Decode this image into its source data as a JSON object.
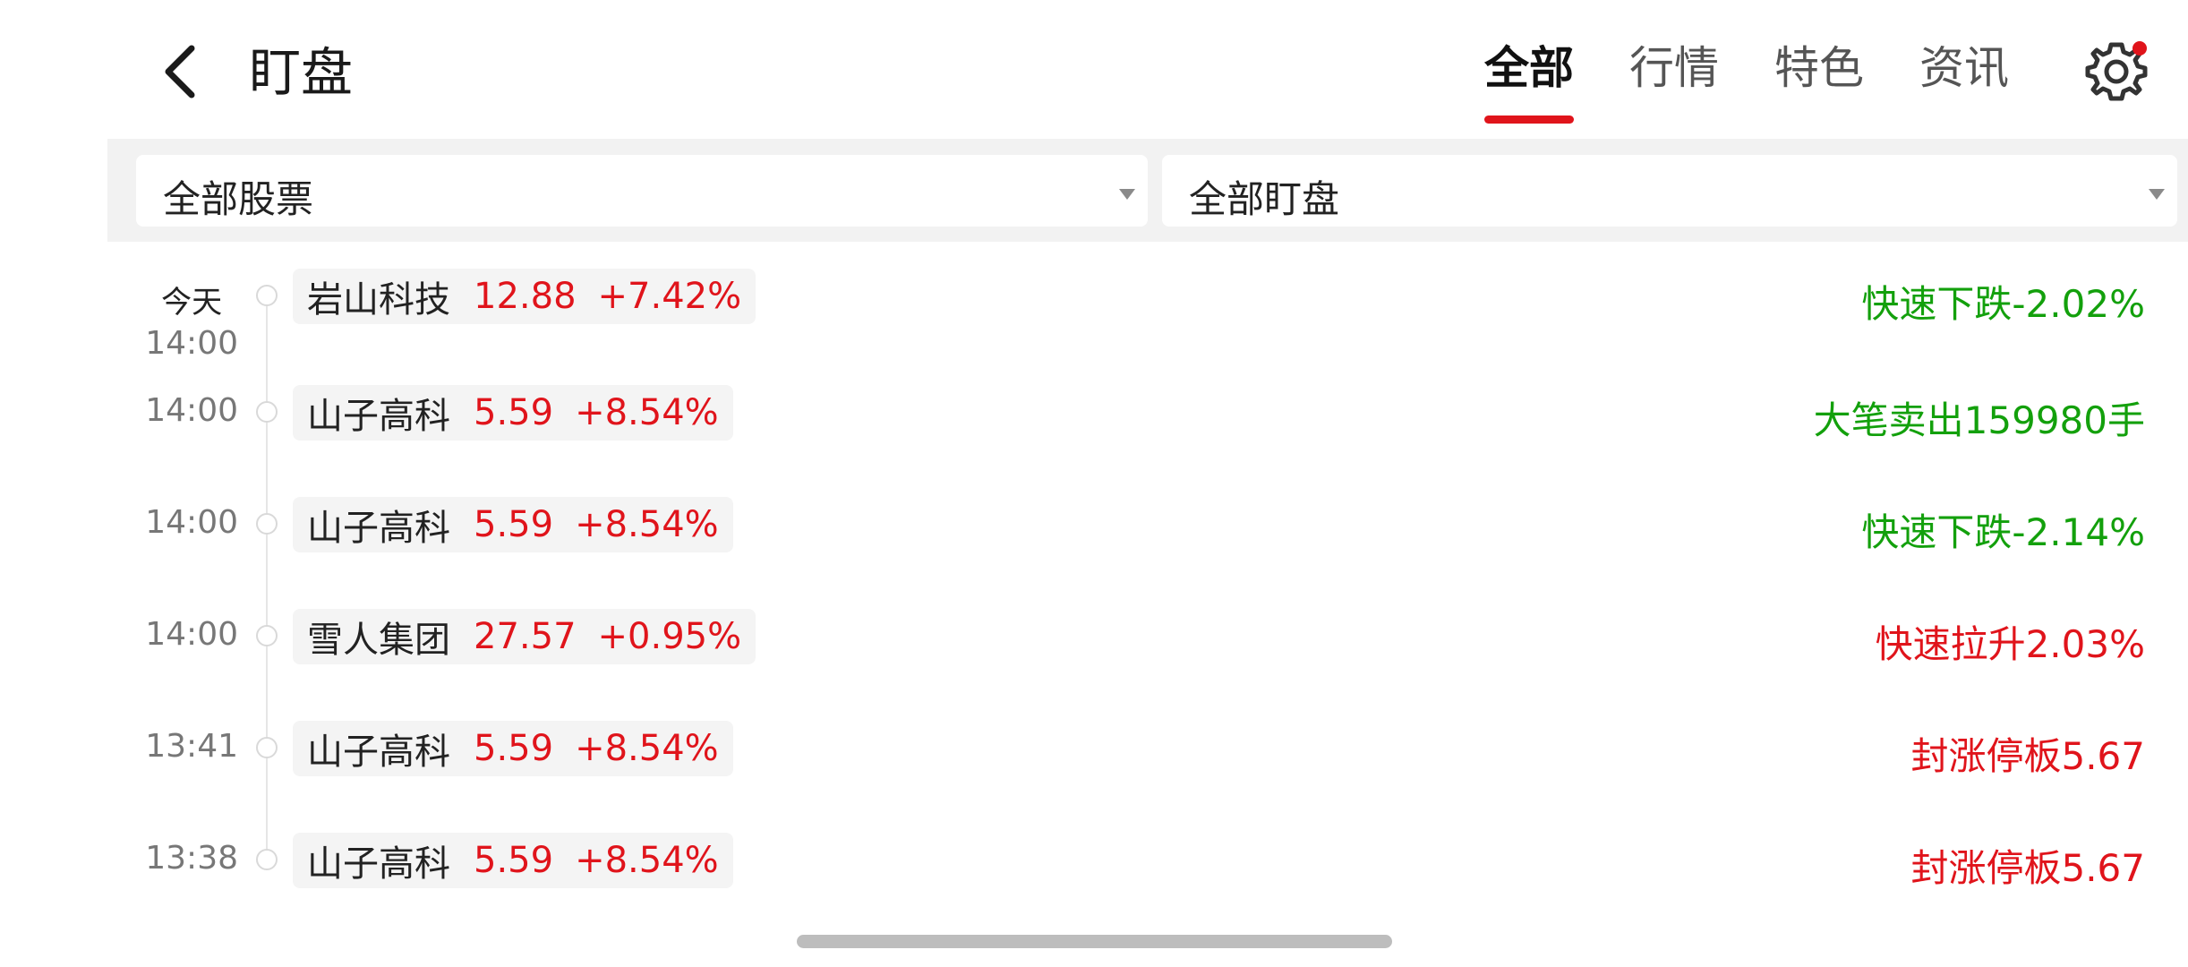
{
  "header": {
    "back_icon": "chevron-left-icon",
    "title": "盯盘",
    "tabs": [
      {
        "label": "全部",
        "active": true
      },
      {
        "label": "行情",
        "active": false
      },
      {
        "label": "特色",
        "active": false
      },
      {
        "label": "资讯",
        "active": false
      }
    ],
    "settings_icon": "gear-icon",
    "notification_dot": true
  },
  "filters": {
    "stocks": {
      "label": "全部股票"
    },
    "watch": {
      "label": "全部盯盘"
    }
  },
  "timeline": [
    {
      "day": "今天",
      "time": "14:00",
      "stock": "岩山科技",
      "price": "12.88",
      "change": "+7.42%",
      "event": "快速下跌-2.02%",
      "event_type": "down"
    },
    {
      "day": "",
      "time": "14:00",
      "stock": "山子高科",
      "price": "5.59",
      "change": "+8.54%",
      "event": "大笔卖出159980手",
      "event_type": "down"
    },
    {
      "day": "",
      "time": "14:00",
      "stock": "山子高科",
      "price": "5.59",
      "change": "+8.54%",
      "event": "快速下跌-2.14%",
      "event_type": "down"
    },
    {
      "day": "",
      "time": "14:00",
      "stock": "雪人集团",
      "price": "27.57",
      "change": "+0.95%",
      "event": "快速拉升2.03%",
      "event_type": "up"
    },
    {
      "day": "",
      "time": "13:41",
      "stock": "山子高科",
      "price": "5.59",
      "change": "+8.54%",
      "event": "封涨停板5.67",
      "event_type": "up"
    },
    {
      "day": "",
      "time": "13:38",
      "stock": "山子高科",
      "price": "5.59",
      "change": "+8.54%",
      "event": "封涨停板5.67",
      "event_type": "up"
    }
  ],
  "colors": {
    "accent": "#e0141b",
    "down": "#13a00c",
    "up": "#e0141b"
  }
}
